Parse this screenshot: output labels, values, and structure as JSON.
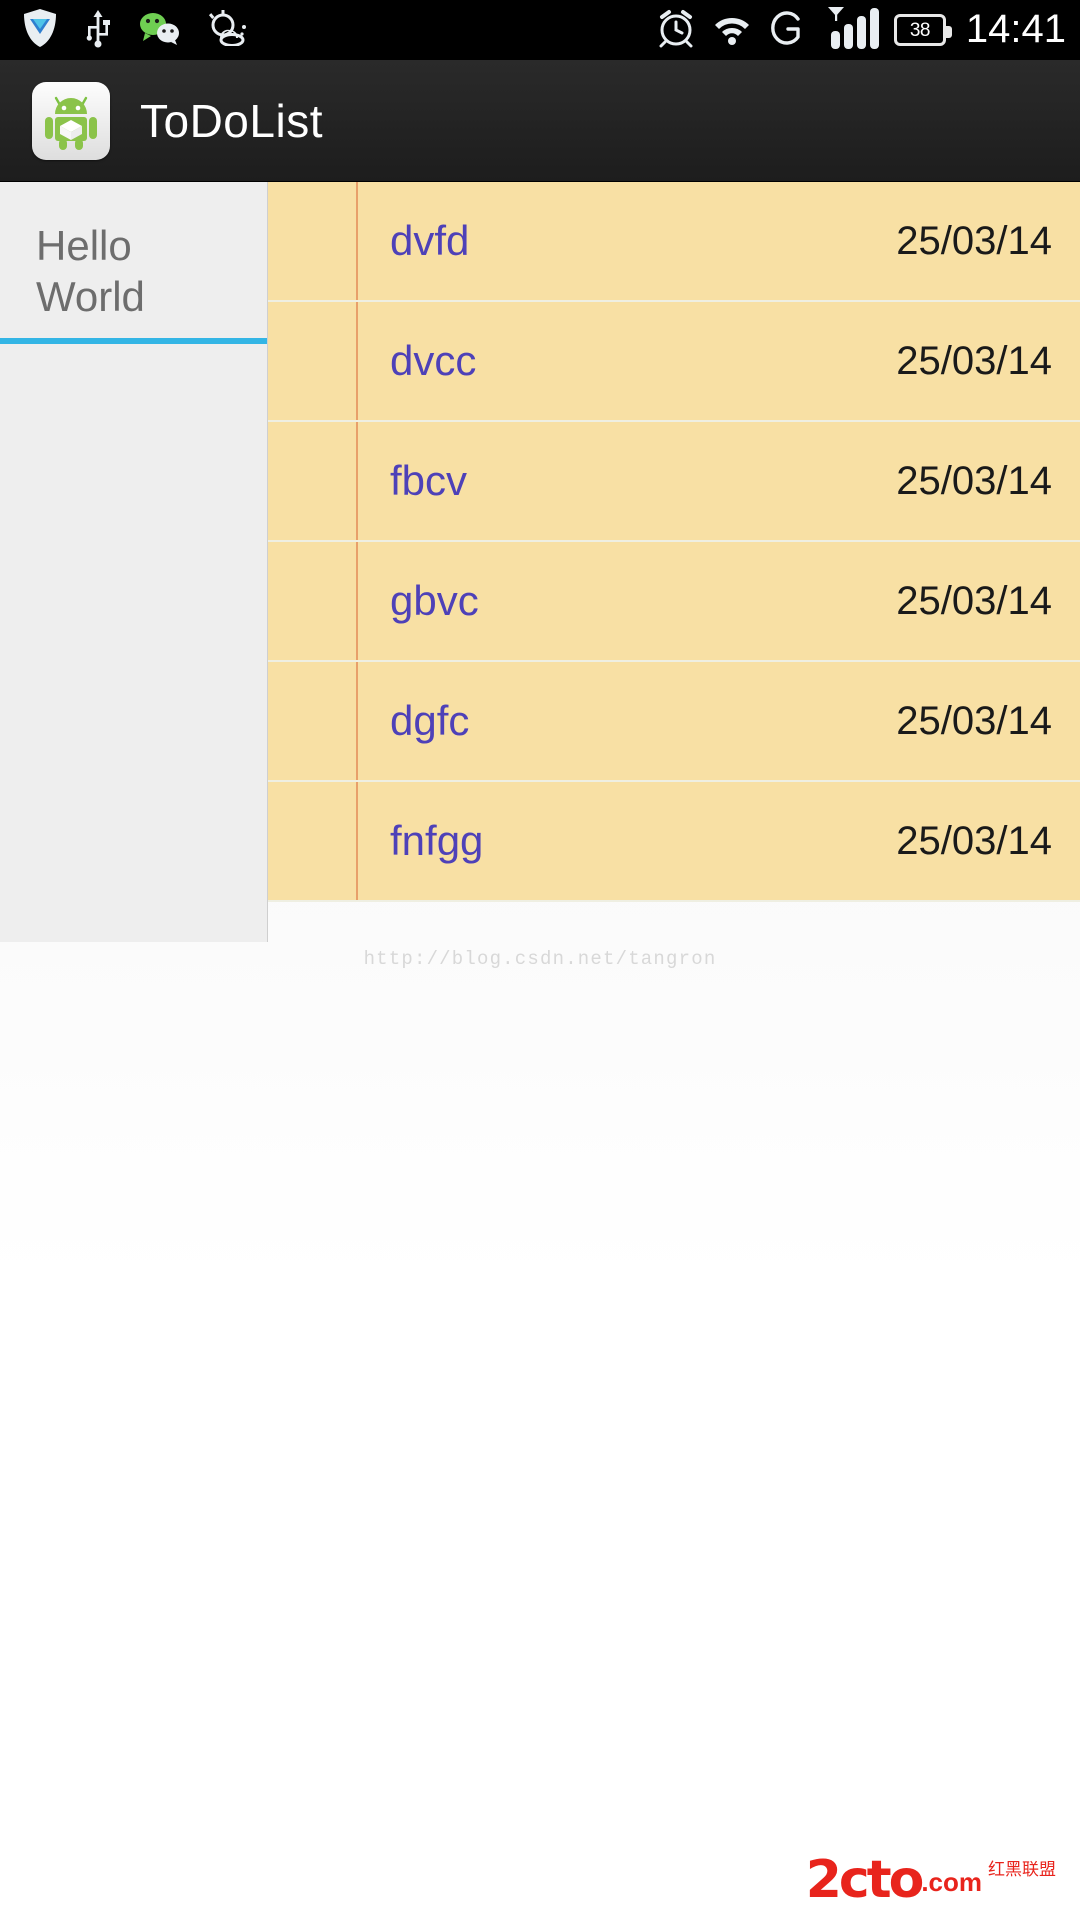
{
  "status_bar": {
    "left_icons": [
      {
        "name": "security-shield-icon",
        "label": "Shield"
      },
      {
        "name": "usb-icon",
        "label": "USB"
      },
      {
        "name": "wechat-icon",
        "label": "WeChat"
      },
      {
        "name": "weather-icon",
        "label": "Weather"
      }
    ],
    "right_icons": [
      {
        "name": "alarm-clock-icon",
        "label": "Alarm"
      },
      {
        "name": "wifi-icon",
        "label": "Wi-Fi"
      },
      {
        "name": "gprs-g-icon",
        "label": "G"
      },
      {
        "name": "signal-bars-icon",
        "label": "Signal"
      }
    ],
    "battery_level": "38",
    "time": "14:41"
  },
  "action_bar": {
    "app_icon": "android-robot-icon",
    "title": "ToDoList"
  },
  "tabs": [
    {
      "label": "Hello World",
      "selected": true
    }
  ],
  "list": {
    "columns": [
      "title",
      "date"
    ],
    "rows": [
      {
        "title": "dvfd",
        "date": "25/03/14"
      },
      {
        "title": "dvcc",
        "date": "25/03/14"
      },
      {
        "title": "fbcv",
        "date": "25/03/14"
      },
      {
        "title": "gbvc",
        "date": "25/03/14"
      },
      {
        "title": "dgfc",
        "date": "25/03/14"
      },
      {
        "title": "fnfgg",
        "date": "25/03/14"
      }
    ]
  },
  "watermark": "http://blog.csdn.net/tangron",
  "brand": {
    "main": "2cto",
    "domain": ".com",
    "cn": "红黑联盟"
  },
  "colors": {
    "status_bar_bg": "#000000",
    "action_bar_bg": "#222222",
    "tab_indicator": "#33b5e5",
    "row_bg": "#f8e0a4",
    "row_title": "#4e41b8",
    "row_divider": "#e8a06a",
    "brand_red": "#e8241c"
  }
}
